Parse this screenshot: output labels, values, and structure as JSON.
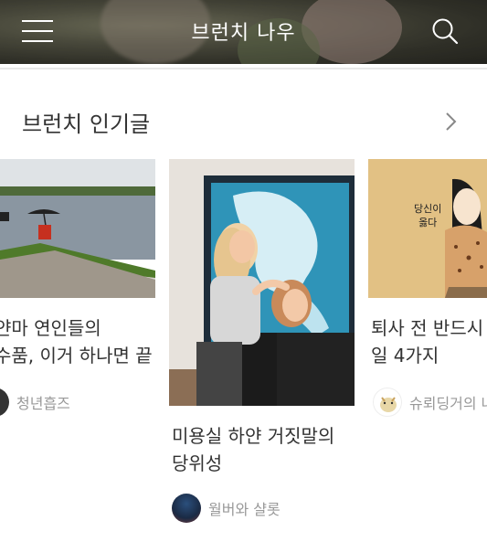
{
  "header": {
    "brand": "브런치 나우",
    "menu_icon": "hamburger-menu-icon",
    "search_icon": "search-icon",
    "background_color": "#4a4a3c"
  },
  "section": {
    "title": "브런치 인기글",
    "next_icon": "chevron-right-icon"
  },
  "cards": [
    {
      "title_lines": [
        "얀마 연인들의",
        "수품, 이거 하나면 끝"
      ],
      "author": "청년흡즈"
    },
    {
      "title_lines": [
        "미용실 하얀 거짓말의",
        "당위성"
      ],
      "author": "월버와 샬롯"
    },
    {
      "title_lines": [
        "퇴사 전 반드시 하",
        "일 4가지"
      ],
      "author": "슈뢰딩거의 냐",
      "image_text": [
        "당신이",
        "옳다"
      ]
    }
  ],
  "colors": {
    "text": "#333333",
    "muted": "#999999",
    "comic_bg": "#e2c184"
  }
}
